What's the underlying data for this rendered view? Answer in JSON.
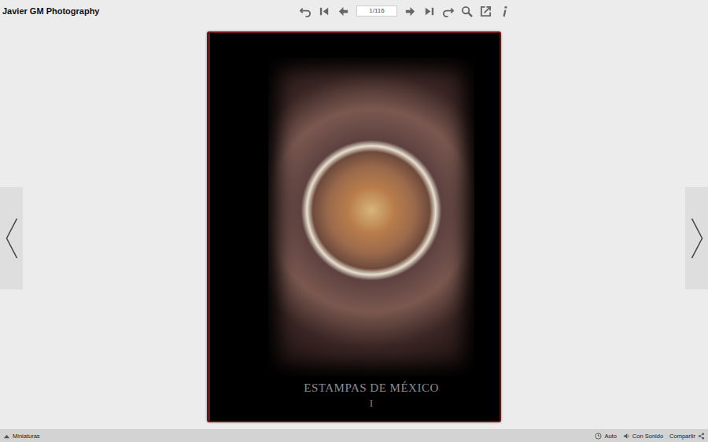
{
  "app": {
    "title": "Javier GM Photography"
  },
  "toolbar": {
    "page": "1/116"
  },
  "cover": {
    "title": "ESTAMPAS DE MÉXICO",
    "volume": "I"
  },
  "status_bar": {
    "thumbnails": "Miniaturas",
    "auto": "Auto",
    "sound": "Con Sonido",
    "share": "Compartir"
  }
}
